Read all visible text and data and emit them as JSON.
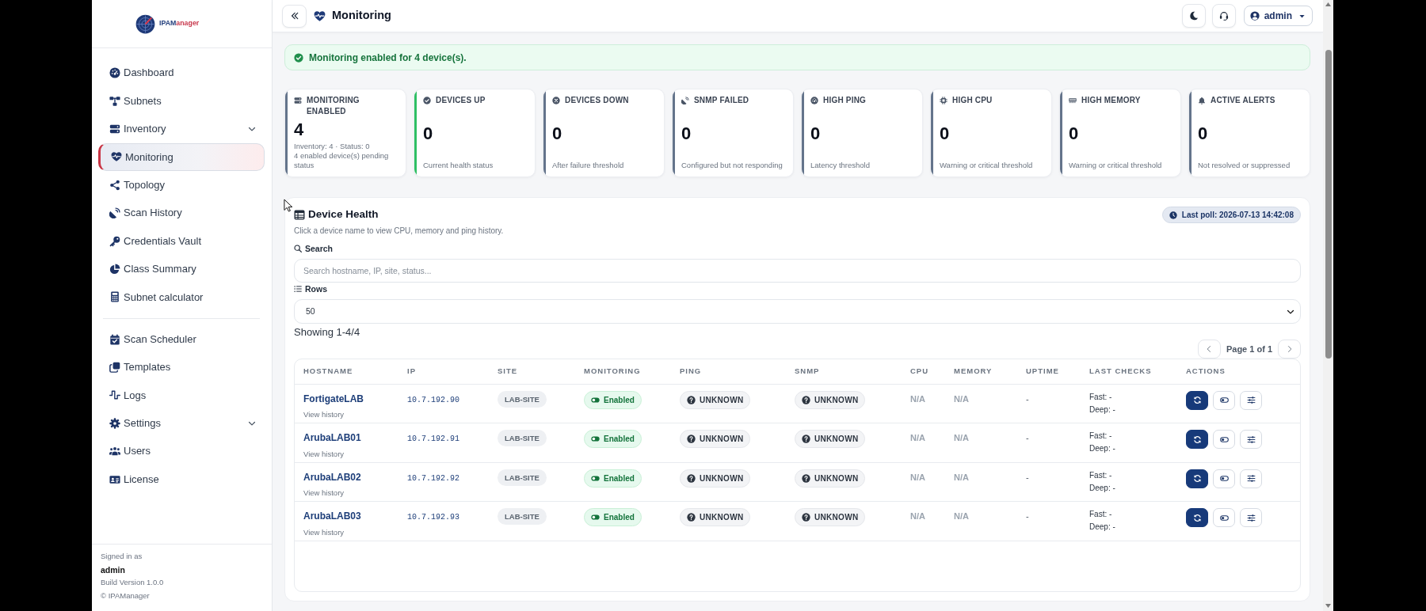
{
  "sidebar": {
    "logo": {
      "parts": [
        "IPAM",
        "anager"
      ]
    },
    "sections": [
      {
        "items": [
          {
            "label": "Dashboard",
            "kind": "link",
            "selected": false
          },
          {
            "label": "Subnets",
            "kind": "link",
            "selected": false
          },
          {
            "label": "Inventory",
            "kind": "group",
            "expanded": false,
            "selected": false
          },
          {
            "label": "Monitoring",
            "kind": "link",
            "selected": true
          },
          {
            "label": "Topology",
            "kind": "link",
            "selected": false
          },
          {
            "label": "Scan History",
            "kind": "link",
            "selected": false
          },
          {
            "label": "Credentials Vault",
            "kind": "link",
            "selected": false
          },
          {
            "label": "Class Summary",
            "kind": "link",
            "selected": false
          },
          {
            "label": "Subnet calculator",
            "kind": "link",
            "selected": false
          }
        ]
      },
      {
        "items": [
          {
            "label": "Scan Scheduler",
            "kind": "link",
            "selected": false
          },
          {
            "label": "Templates",
            "kind": "link",
            "selected": false
          },
          {
            "label": "Logs",
            "kind": "link",
            "selected": false
          },
          {
            "label": "Settings",
            "kind": "group",
            "expanded": false,
            "selected": false
          },
          {
            "label": "Users",
            "kind": "link",
            "selected": false
          },
          {
            "label": "License",
            "kind": "link",
            "selected": false
          }
        ]
      }
    ],
    "footer": {
      "signed_in_label": "Signed in as",
      "user": "admin",
      "build": "Build Version 1.0.0",
      "copyright": "© IPAManager"
    }
  },
  "header": {
    "title": "Monitoring",
    "user_menu": "admin"
  },
  "alert": {
    "message": "Monitoring enabled for 4 device(s)."
  },
  "stats": [
    {
      "label": "MONITORING ENABLED",
      "value": "4",
      "notes": [
        "Inventory: 4 · Status: 0",
        "4 enabled device(s) pending status"
      ],
      "color": "#64748b"
    },
    {
      "label": "DEVICES UP",
      "value": "0",
      "notes": [
        "Current health status"
      ],
      "color": "#2fbf64"
    },
    {
      "label": "DEVICES DOWN",
      "value": "0",
      "notes": [
        "After failure threshold"
      ],
      "color": "#64748b"
    },
    {
      "label": "SNMP FAILED",
      "value": "0",
      "notes": [
        "Configured but not responding"
      ],
      "color": "#64748b"
    },
    {
      "label": "HIGH PING",
      "value": "0",
      "notes": [
        "Latency threshold"
      ],
      "color": "#64748b"
    },
    {
      "label": "HIGH CPU",
      "value": "0",
      "notes": [
        "Warning or critical threshold"
      ],
      "color": "#64748b"
    },
    {
      "label": "HIGH MEMORY",
      "value": "0",
      "notes": [
        "Warning or critical threshold"
      ],
      "color": "#64748b"
    },
    {
      "label": "ACTIVE ALERTS",
      "value": "0",
      "notes": [
        "Not resolved or suppressed"
      ],
      "color": "#64748b"
    }
  ],
  "device_health": {
    "title": "Device Health",
    "subtitle": "Click a device name to view CPU, memory and ping history.",
    "last_poll": "Last poll: 2026-07-13 14:42:08",
    "search": {
      "label": "Search",
      "placeholder": "Search hostname, IP, site, status..."
    },
    "rows_select": {
      "label": "Rows",
      "value": "50"
    },
    "showing": "Showing 1-4/4",
    "pagination": {
      "label": "Page 1 of 1"
    },
    "table": {
      "columns": [
        "HOSTNAME",
        "IP",
        "SITE",
        "MONITORING",
        "PING",
        "SNMP",
        "CPU",
        "MEMORY",
        "UPTIME",
        "LAST CHECKS",
        "ACTIONS"
      ],
      "rows": [
        {
          "hostname": "FortigateLAB",
          "history_link": "View history",
          "ip": "10.7.192.90",
          "site": "LAB-SITE",
          "monitoring": {
            "label": "Enabled",
            "enabled": true
          },
          "ping": "UNKNOWN",
          "snmp": "UNKNOWN",
          "cpu": "N/A",
          "memory": "N/A",
          "uptime": "-",
          "last_checks": [
            "Fast: -",
            "Deep: -"
          ]
        },
        {
          "hostname": "ArubaLAB01",
          "history_link": "View history",
          "ip": "10.7.192.91",
          "site": "LAB-SITE",
          "monitoring": {
            "label": "Enabled",
            "enabled": true
          },
          "ping": "UNKNOWN",
          "snmp": "UNKNOWN",
          "cpu": "N/A",
          "memory": "N/A",
          "uptime": "-",
          "last_checks": [
            "Fast: -",
            "Deep: -"
          ]
        },
        {
          "hostname": "ArubaLAB02",
          "history_link": "View history",
          "ip": "10.7.192.92",
          "site": "LAB-SITE",
          "monitoring": {
            "label": "Enabled",
            "enabled": true
          },
          "ping": "UNKNOWN",
          "snmp": "UNKNOWN",
          "cpu": "N/A",
          "memory": "N/A",
          "uptime": "-",
          "last_checks": [
            "Fast: -",
            "Deep: -"
          ]
        },
        {
          "hostname": "ArubaLAB03",
          "history_link": "View history",
          "ip": "10.7.192.93",
          "site": "LAB-SITE",
          "monitoring": {
            "label": "Enabled",
            "enabled": true
          },
          "ping": "UNKNOWN",
          "snmp": "UNKNOWN",
          "cpu": "N/A",
          "memory": "N/A",
          "uptime": "-",
          "last_checks": [
            "Fast: -",
            "Deep: -"
          ]
        }
      ]
    }
  }
}
